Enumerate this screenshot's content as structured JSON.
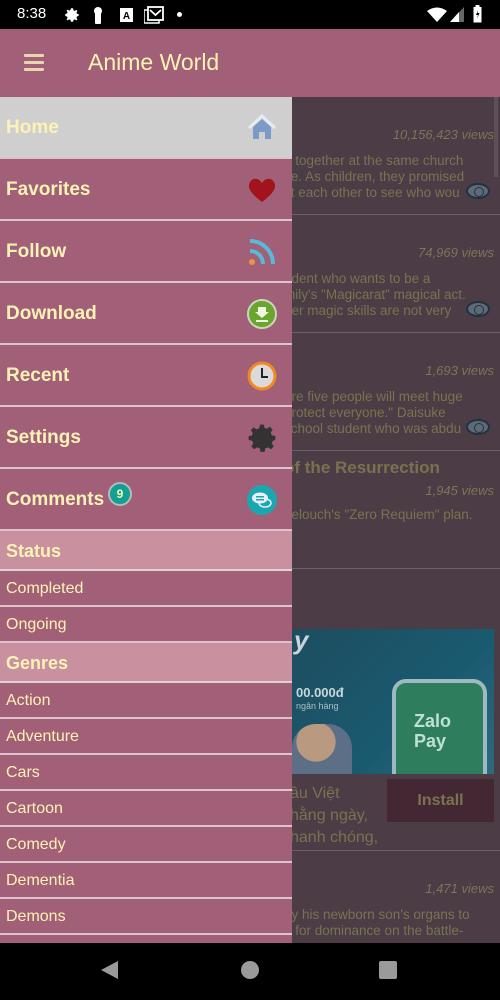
{
  "status_bar": {
    "time": "8:38",
    "left_icons": [
      "settings-icon",
      "keyhole-icon",
      "font-a-icon",
      "gmail-icon",
      "dot-icon"
    ],
    "right_icons": [
      "wifi-icon",
      "signal-icon",
      "battery-charging-icon"
    ]
  },
  "app_bar": {
    "title": "Anime World",
    "menu_icon": "hamburger-icon"
  },
  "drawer": {
    "nav_items": [
      {
        "label": "Home",
        "icon": "home-icon",
        "active": true
      },
      {
        "label": "Favorites",
        "icon": "heart-icon"
      },
      {
        "label": "Follow",
        "icon": "rss-icon"
      },
      {
        "label": "Download",
        "icon": "download-icon"
      },
      {
        "label": "Recent",
        "icon": "clock-icon"
      },
      {
        "label": "Settings",
        "icon": "gear-icon"
      },
      {
        "label": "Comments",
        "icon": "chat-icon",
        "badge": "9"
      }
    ],
    "status_section": {
      "title": "Status",
      "items": [
        "Completed",
        "Ongoing"
      ]
    },
    "genres_section": {
      "title": "Genres",
      "items": [
        "Action",
        "Adventure",
        "Cars",
        "Cartoon",
        "Comedy",
        "Dementia",
        "Demons"
      ]
    }
  },
  "background_list": {
    "cards": [
      {
        "views": "10,156,423 views",
        "desc": [
          "d together at the same church",
          "ce. As children, they promised",
          "st each other to see who wou"
        ]
      },
      {
        "views": "74,969 views",
        "desc": [
          "udent who wants to be a",
          "mily's \"Magicarat\" magical act.",
          " her magic skills are not very"
        ]
      },
      {
        "views": "1,693 views",
        "desc": [
          "ere five people will meet huge",
          "protect everyone.\" Daisuke",
          "school student who was abdu"
        ]
      },
      {
        "title": "of the Resurrection",
        "views": "1,945 views",
        "desc": [
          " Lelouch's \"Zero Requiem\" plan."
        ]
      },
      {
        "views": "1,471 views",
        "desc": [
          "ay his newborn son's organs to",
          "e for dominance on the battle-"
        ]
      }
    ],
    "ad": {
      "headline_fragment": "y",
      "amount": "00.000đ",
      "subtext": "ngân hàng",
      "brand_line1": "Zalo",
      "brand_line2": "Pay",
      "text_lines": [
        "ầu Việt",
        "hằng ngày,",
        "hanh chóng,"
      ],
      "install_label": "Install"
    }
  },
  "nav_bar": {
    "buttons": [
      "back",
      "home",
      "recents"
    ]
  },
  "colors": {
    "primary": "#a25f78",
    "section_header": "#c9909f",
    "text_accent": "#fbf3b5",
    "active_item": "#cfcfcf",
    "badge": "#12a095"
  }
}
